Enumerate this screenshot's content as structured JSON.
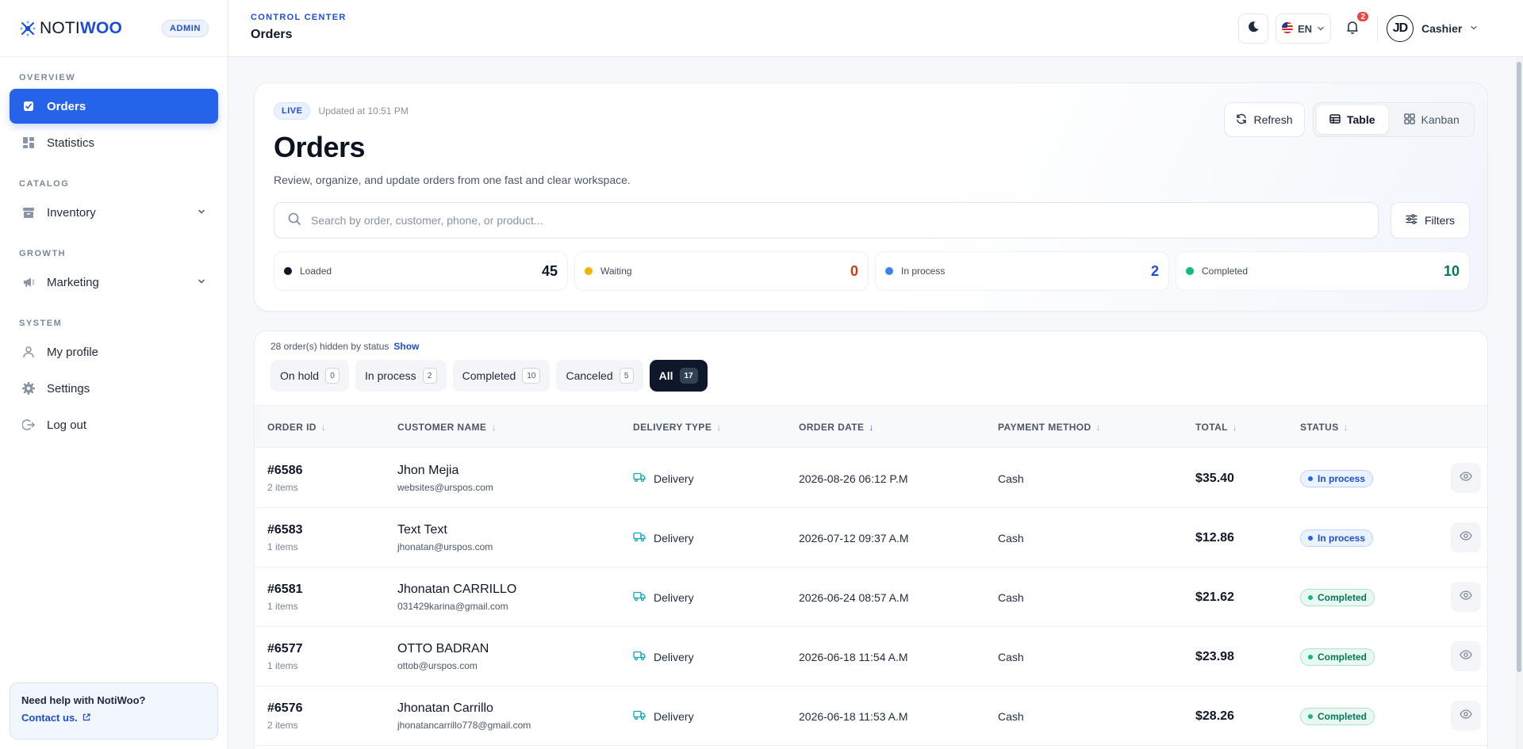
{
  "brand": {
    "name_part1": "NOTI",
    "name_part2": "WOO",
    "role_badge": "ADMIN"
  },
  "sidebar": {
    "sections": [
      {
        "label": "OVERVIEW",
        "items": [
          {
            "label": "Orders",
            "icon": "clipboard-check-icon",
            "active": true
          },
          {
            "label": "Statistics",
            "icon": "dashboard-grid-icon"
          }
        ]
      },
      {
        "label": "CATALOG",
        "items": [
          {
            "label": "Inventory",
            "icon": "archive-box-icon",
            "expandable": true
          }
        ]
      },
      {
        "label": "GROWTH",
        "items": [
          {
            "label": "Marketing",
            "icon": "megaphone-icon",
            "expandable": true
          }
        ]
      },
      {
        "label": "SYSTEM",
        "items": [
          {
            "label": "My profile",
            "icon": "user-icon"
          },
          {
            "label": "Settings",
            "icon": "gear-icon"
          },
          {
            "label": "Log out",
            "icon": "logout-icon"
          }
        ]
      }
    ],
    "help": {
      "title": "Need help with NotiWoo?",
      "link": "Contact us."
    }
  },
  "topbar": {
    "section_label": "CONTROL CENTER",
    "page_title": "Orders",
    "language": "EN",
    "notification_count": "2",
    "user": {
      "initials": "JD",
      "name": "Cashier"
    }
  },
  "hero": {
    "live_badge": "LIVE",
    "updated": "Updated at 10:51 PM",
    "title": "Orders",
    "subtitle": "Review, organize, and update orders from one fast and clear workspace.",
    "refresh_label": "Refresh",
    "view_table": "Table",
    "view_kanban": "Kanban",
    "active_view": "Table",
    "search_placeholder": "Search by order, customer, phone, or product...",
    "filters_label": "Filters",
    "stats": [
      {
        "label": "Loaded",
        "value": "45",
        "color": "#0f172a"
      },
      {
        "label": "Waiting",
        "value": "0",
        "color": "#f5b301",
        "value_color": "#c2410c"
      },
      {
        "label": "In process",
        "value": "2",
        "color": "#3b82f6",
        "value_color": "#1d4ed8"
      },
      {
        "label": "Completed",
        "value": "10",
        "color": "#10b981",
        "value_color": "#047857"
      }
    ]
  },
  "table": {
    "hidden_note": "28 order(s) hidden by status",
    "show_label": "Show",
    "filters": [
      {
        "label": "On hold",
        "count": "0"
      },
      {
        "label": "In process",
        "count": "2"
      },
      {
        "label": "Completed",
        "count": "10"
      },
      {
        "label": "Canceled",
        "count": "5"
      },
      {
        "label": "All",
        "count": "17",
        "active": true
      }
    ],
    "columns": [
      "ORDER ID",
      "CUSTOMER NAME",
      "DELIVERY TYPE",
      "ORDER DATE",
      "PAYMENT METHOD",
      "TOTAL",
      "STATUS"
    ],
    "sorted_column": "ORDER DATE",
    "rows": [
      {
        "id": "#6586",
        "items": "2 items",
        "name": "Jhon Mejia",
        "email": "websites@urspos.com",
        "delivery": "Delivery",
        "date": "2026-08-26 06:12 P.M",
        "payment": "Cash",
        "total": "$35.40",
        "status": "In process",
        "status_kind": "inproc"
      },
      {
        "id": "#6583",
        "items": "1 items",
        "name": "Text Text",
        "email": "jhonatan@urspos.com",
        "delivery": "Delivery",
        "date": "2026-07-12 09:37 A.M",
        "payment": "Cash",
        "total": "$12.86",
        "status": "In process",
        "status_kind": "inproc"
      },
      {
        "id": "#6581",
        "items": "1 items",
        "name": "Jhonatan CARRILLO",
        "email": "031429karina@gmail.com",
        "delivery": "Delivery",
        "date": "2026-06-24 08:57 A.M",
        "payment": "Cash",
        "total": "$21.62",
        "status": "Completed",
        "status_kind": "done"
      },
      {
        "id": "#6577",
        "items": "1 items",
        "name": "OTTO BADRAN",
        "email": "ottob@urspos.com",
        "delivery": "Delivery",
        "date": "2026-06-18 11:54 A.M",
        "payment": "Cash",
        "total": "$23.98",
        "status": "Completed",
        "status_kind": "done"
      },
      {
        "id": "#6576",
        "items": "2 items",
        "name": "Jhonatan Carrillo",
        "email": "jhonatancarrillo778@gmail.com",
        "delivery": "Delivery",
        "date": "2026-06-18 11:53 A.M",
        "payment": "Cash",
        "total": "$28.26",
        "status": "Completed",
        "status_kind": "done"
      }
    ]
  }
}
